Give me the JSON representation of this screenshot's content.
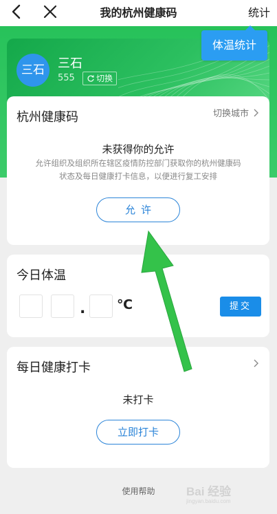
{
  "nav": {
    "title": "我的杭州健康码",
    "right_label": "统计",
    "back_icon": "back-arrow-icon",
    "close_icon": "close-icon"
  },
  "user": {
    "avatar_text": "三石",
    "name": "三石",
    "id": "555",
    "switch_label": "切换",
    "switch_icon": "refresh-icon"
  },
  "tooltip": {
    "label": "体温统计"
  },
  "health_code": {
    "title": "杭州健康码",
    "switch_city_label": "切换城市",
    "permission_heading": "未获得你的允许",
    "permission_desc_line1": "允许组织及组织所在辖区疫情防控部门获取你的杭州健康码",
    "permission_desc_line2": "状态及每日健康打卡信息，以便进行复工安排",
    "allow_button": "允许"
  },
  "temperature": {
    "title": "今日体温",
    "dot": ".",
    "unit": "℃",
    "submit_button": "提交"
  },
  "checkin": {
    "title": "每日健康打卡",
    "status": "未打卡",
    "checkin_button": "立即打卡"
  },
  "footer": {
    "help_label": "使用帮助"
  },
  "watermark": {
    "brand": "Bai 经验",
    "url": "jingyan.baidu.com"
  },
  "colors": {
    "green": "#27c25a",
    "accent_blue": "#2b84d8",
    "tooltip_blue": "#2b9df2",
    "arrow_green": "#34c24a"
  }
}
